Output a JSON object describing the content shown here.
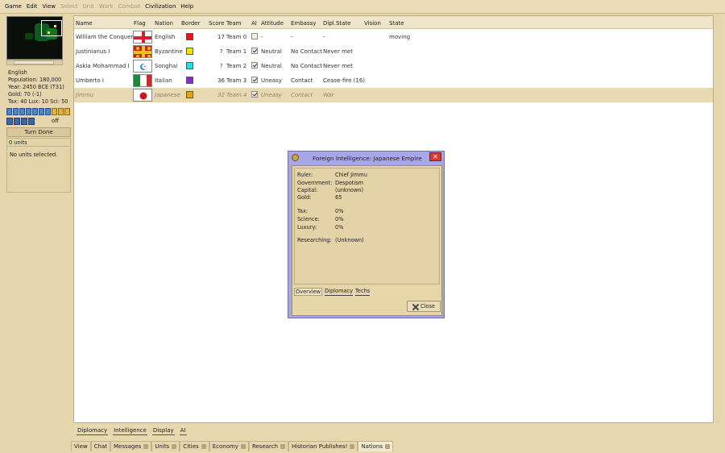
{
  "menu": [
    {
      "label": "Game",
      "enabled": true
    },
    {
      "label": "Edit",
      "enabled": true
    },
    {
      "label": "View",
      "enabled": true
    },
    {
      "label": "Select",
      "enabled": false
    },
    {
      "label": "Unit",
      "enabled": false
    },
    {
      "label": "Work",
      "enabled": false
    },
    {
      "label": "Combat",
      "enabled": false
    },
    {
      "label": "Civilization",
      "enabled": true
    },
    {
      "label": "Help",
      "enabled": true
    }
  ],
  "info": {
    "nation": "English",
    "population": "Population: 180,000",
    "year": "Year: 2450 BCE (T31)",
    "gold": "Gold: 70 (-1)",
    "rates": "Tax: 40 Lux: 10 Sci: 50",
    "off_label": "off",
    "turn_done": "Turn Done",
    "units_count": "0 units",
    "no_units": "No units selected."
  },
  "table": {
    "headers": [
      "Name",
      "Flag",
      "Nation",
      "Border",
      "Score",
      "Team",
      "AI",
      "Attitude",
      "Embassy",
      "Dipl.State",
      "Vision",
      "State"
    ],
    "rows": [
      {
        "name": "William the Conqueror",
        "flag": "england-flag",
        "nation": "English",
        "border": "#e01818",
        "score": "17",
        "team": "Team 0",
        "ai": false,
        "attitude": "-",
        "embassy": "-",
        "dipl": "-",
        "vision": "",
        "state": "moving"
      },
      {
        "name": "Justinianus I",
        "flag": "byzantine-flag",
        "nation": "Byzantine",
        "border": "#f0e020",
        "score": "?",
        "team": "Team 1",
        "ai": true,
        "attitude": "Neutral",
        "embassy": "No Contact",
        "dipl": "Never met",
        "vision": "",
        "state": ""
      },
      {
        "name": "Askia Mohammad I",
        "flag": "songhai-flag",
        "nation": "Songhai",
        "border": "#30d8e0",
        "score": "?",
        "team": "Team 2",
        "ai": true,
        "attitude": "Neutral",
        "embassy": "No Contact",
        "dipl": "Never met",
        "vision": "",
        "state": ""
      },
      {
        "name": "Umberto I",
        "flag": "italy-flag",
        "nation": "Italian",
        "border": "#8030c0",
        "score": "36",
        "team": "Team 3",
        "ai": true,
        "attitude": "Uneasy",
        "embassy": "Contact",
        "dipl": "Cease-fire (16)",
        "vision": "",
        "state": ""
      },
      {
        "name": "Jimmu",
        "flag": "japan-flag",
        "nation": "Japanese",
        "border": "#e8a020",
        "score": "32",
        "team": "Team 4",
        "ai": true,
        "attitude": "Uneasy",
        "embassy": "Contact",
        "dipl": "War",
        "vision": "",
        "state": ""
      }
    ]
  },
  "subtabs": [
    "Diplomacy",
    "Intelligence",
    "Display",
    "AI"
  ],
  "bottomtabs": [
    "View",
    "Chat",
    "Messages",
    "Units",
    "Cities",
    "Economy",
    "Research",
    "Historian Publishes!",
    "Nations"
  ],
  "dialog": {
    "title": "Foreign Intelligence: Japanese Empire",
    "fields": [
      {
        "label": "Ruler:",
        "value": "Chief Jimmu"
      },
      {
        "label": "Government:",
        "value": "Despotism"
      },
      {
        "label": "Capital:",
        "value": "(unknown)"
      },
      {
        "label": "Gold:",
        "value": "65"
      },
      {
        "label": "Tax:",
        "value": "0%"
      },
      {
        "label": "Science:",
        "value": "0%"
      },
      {
        "label": "Luxury:",
        "value": "0%"
      },
      {
        "label": "Researching:",
        "value": "(Unknown)"
      }
    ],
    "tabs": [
      "Overview",
      "Diplomacy",
      "Techs"
    ],
    "close_label": "Close"
  }
}
